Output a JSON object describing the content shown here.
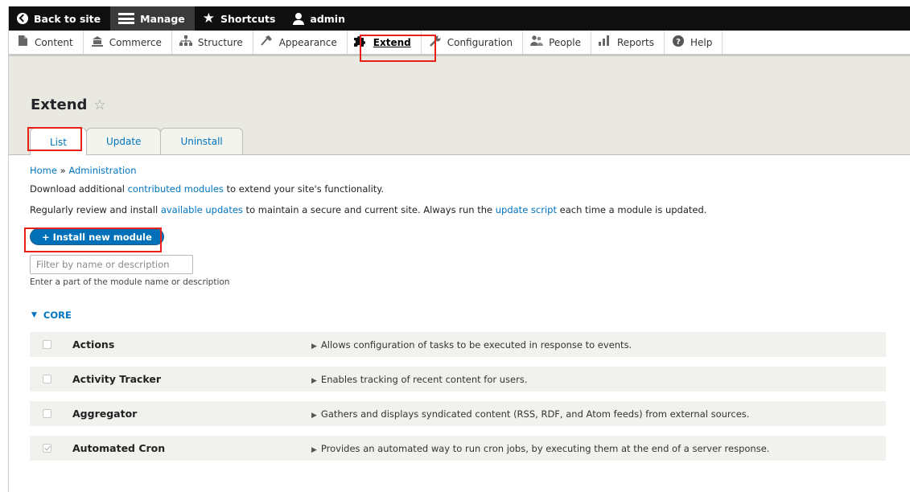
{
  "toolbar": {
    "items": [
      {
        "label": "Back to site",
        "icon": "back-arrow-circle-icon"
      },
      {
        "label": "Manage",
        "icon": "hamburger-menu-icon"
      },
      {
        "label": "Shortcuts",
        "icon": "star-icon"
      },
      {
        "label": "admin",
        "icon": "user-icon"
      }
    ]
  },
  "tray": {
    "items": [
      {
        "label": "Content",
        "icon": "content-icon"
      },
      {
        "label": "Commerce",
        "icon": "commerce-icon"
      },
      {
        "label": "Structure",
        "icon": "structure-icon"
      },
      {
        "label": "Appearance",
        "icon": "appearance-icon"
      },
      {
        "label": "Extend",
        "icon": "puzzle-icon"
      },
      {
        "label": "Configuration",
        "icon": "wrench-icon"
      },
      {
        "label": "People",
        "icon": "people-icon"
      },
      {
        "label": "Reports",
        "icon": "bar-chart-icon"
      },
      {
        "label": "Help",
        "icon": "help-icon"
      }
    ]
  },
  "page": {
    "title": "Extend",
    "tabs": [
      "List",
      "Update",
      "Uninstall"
    ]
  },
  "breadcrumb": {
    "home": "Home",
    "separator": "»",
    "admin": "Administration"
  },
  "intro": {
    "line1_pre": "Download additional ",
    "line1_link": "contributed modules",
    "line1_post": " to extend your site's functionality.",
    "line2_pre": "Regularly review and install ",
    "line2_link1": "available updates",
    "line2_mid": " to maintain a secure and current site. Always run the ",
    "line2_link2": "update script",
    "line2_post": " each time a module is updated."
  },
  "install_button": "+ Install new module",
  "filter": {
    "placeholder": "Filter by name or description",
    "hint": "Enter a part of the module name or description"
  },
  "core": {
    "label": "CORE",
    "modules": [
      {
        "name": "Actions",
        "desc": "Allows configuration of tasks to be executed in response to events.",
        "checked": false
      },
      {
        "name": "Activity Tracker",
        "desc": "Enables tracking of recent content for users.",
        "checked": false
      },
      {
        "name": "Aggregator",
        "desc": "Gathers and displays syndicated content (RSS, RDF, and Atom feeds) from external sources.",
        "checked": false
      },
      {
        "name": "Automated Cron",
        "desc": "Provides an automated way to run cron jobs, by executing them at the end of a server response.",
        "checked": true
      }
    ]
  },
  "colors": {
    "accent": "#0074bd",
    "highlight": "#e8201a",
    "toolbar": "#0f0f0f"
  }
}
